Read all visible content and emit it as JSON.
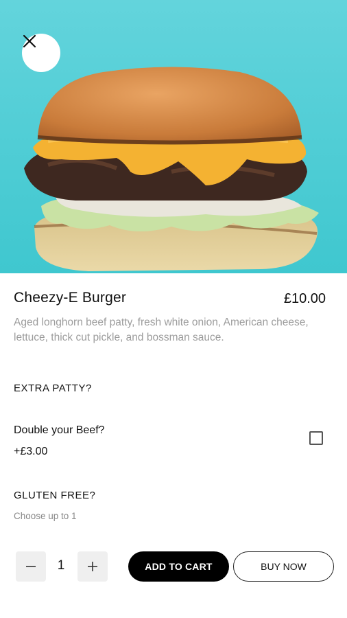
{
  "hero": {
    "image": "burger-photo",
    "background_color": "#4fd0d6"
  },
  "header": {
    "close_icon": "close-icon"
  },
  "product": {
    "name": "Cheezy-E Burger",
    "price": "£10.00",
    "description": "Aged longhorn beef patty, fresh white onion, American cheese, lettuce, thick cut pickle, and bossman sauce."
  },
  "options": {
    "extra_patty": {
      "label": "EXTRA PATTY?",
      "item_name": "Double your Beef?",
      "item_price": "+£3.00",
      "checked": false
    },
    "gluten_free": {
      "label": "GLUTEN FREE?",
      "hint": "Choose up to 1"
    }
  },
  "quantity": {
    "value": "1",
    "minus_icon": "minus-icon",
    "plus_icon": "plus-icon"
  },
  "actions": {
    "add_to_cart": "ADD TO CART",
    "buy_now": "BUY NOW"
  },
  "colors": {
    "accent": "#000000",
    "hero_bg": "#4fd0d6",
    "muted_text": "#9c9c9c"
  }
}
